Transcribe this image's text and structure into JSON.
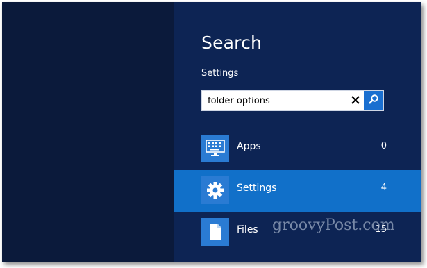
{
  "search_pane": {
    "title": "Search",
    "scope_label": "Settings",
    "query": "folder options",
    "clear_icon": "close-icon",
    "search_icon": "magnifier-icon"
  },
  "results": [
    {
      "label": "Apps",
      "count": "0",
      "icon": "apps-keyboard-icon",
      "selected": false
    },
    {
      "label": "Settings",
      "count": "4",
      "icon": "gear-icon",
      "selected": true
    },
    {
      "label": "Files",
      "count": "15",
      "icon": "document-icon",
      "selected": false
    }
  ],
  "watermark": "groovyPost.com",
  "colors": {
    "background": "#0b1a3b",
    "pane": "#0d2454",
    "accent": "#1170c9",
    "tile": "#2a7bd3"
  }
}
